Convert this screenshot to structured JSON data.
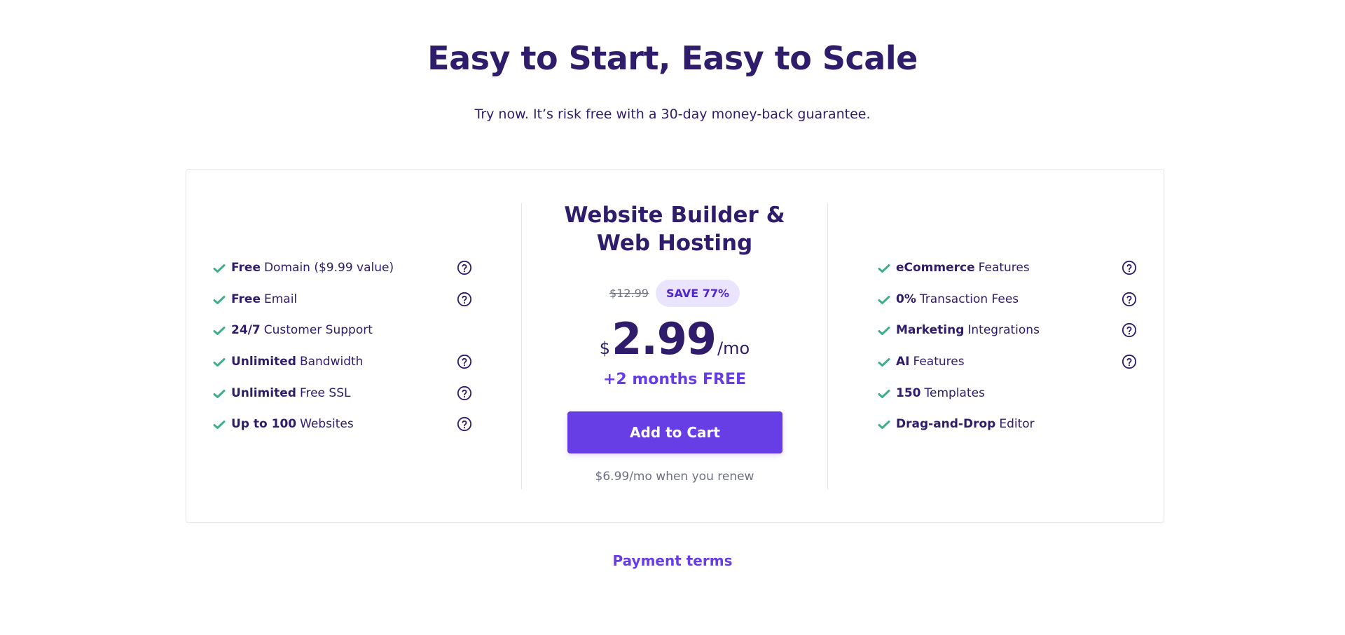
{
  "header": {
    "title": "Easy to Start, Easy to Scale",
    "subtitle": "Try now. It’s risk free with a 30-day money-back guarantee."
  },
  "colors": {
    "primary": "#673de6",
    "text_dark": "#2f1c6a",
    "check_green": "#00b090",
    "muted": "#6d7081",
    "badge_bg": "#ebe4ff"
  },
  "plan": {
    "title": "Website Builder & Web Hosting",
    "old_price": "$12.99",
    "save_badge": "SAVE 77%",
    "currency": "$",
    "price": "2.99",
    "period": "/mo",
    "bonus": "+2 months FREE",
    "cta_label": "Add to Cart",
    "renew_text": "$6.99/mo when you renew"
  },
  "features_left": [
    {
      "bold": "Free",
      "text": "Domain ($9.99 value)",
      "icon": "check-icon",
      "has_help": true
    },
    {
      "bold": "Free",
      "text": "Email",
      "icon": "check-icon",
      "has_help": true
    },
    {
      "bold": "24/7",
      "text": "Customer Support",
      "icon": "check-icon",
      "has_help": false
    },
    {
      "bold": "Unlimited",
      "text": "Bandwidth",
      "icon": "check-icon",
      "has_help": true
    },
    {
      "bold": "Unlimited",
      "text": "Free SSL",
      "icon": "check-icon",
      "has_help": true
    },
    {
      "bold": "Up to 100",
      "text": "Websites",
      "icon": "check-icon",
      "has_help": true
    }
  ],
  "features_right": [
    {
      "bold": "eCommerce",
      "text": "Features",
      "icon": "check-icon",
      "has_help": true
    },
    {
      "bold": "0%",
      "text": "Transaction Fees",
      "icon": "check-icon",
      "has_help": true
    },
    {
      "bold": "Marketing",
      "text": "Integrations",
      "icon": "check-icon",
      "has_help": true
    },
    {
      "bold": "AI",
      "text": "Features",
      "icon": "check-icon",
      "has_help": true
    },
    {
      "bold": "150",
      "text": "Templates",
      "icon": "check-icon",
      "has_help": false
    },
    {
      "bold": "Drag-and-Drop",
      "text": "Editor",
      "icon": "check-icon",
      "has_help": false
    }
  ],
  "footer": {
    "payment_terms_label": "Payment terms"
  }
}
